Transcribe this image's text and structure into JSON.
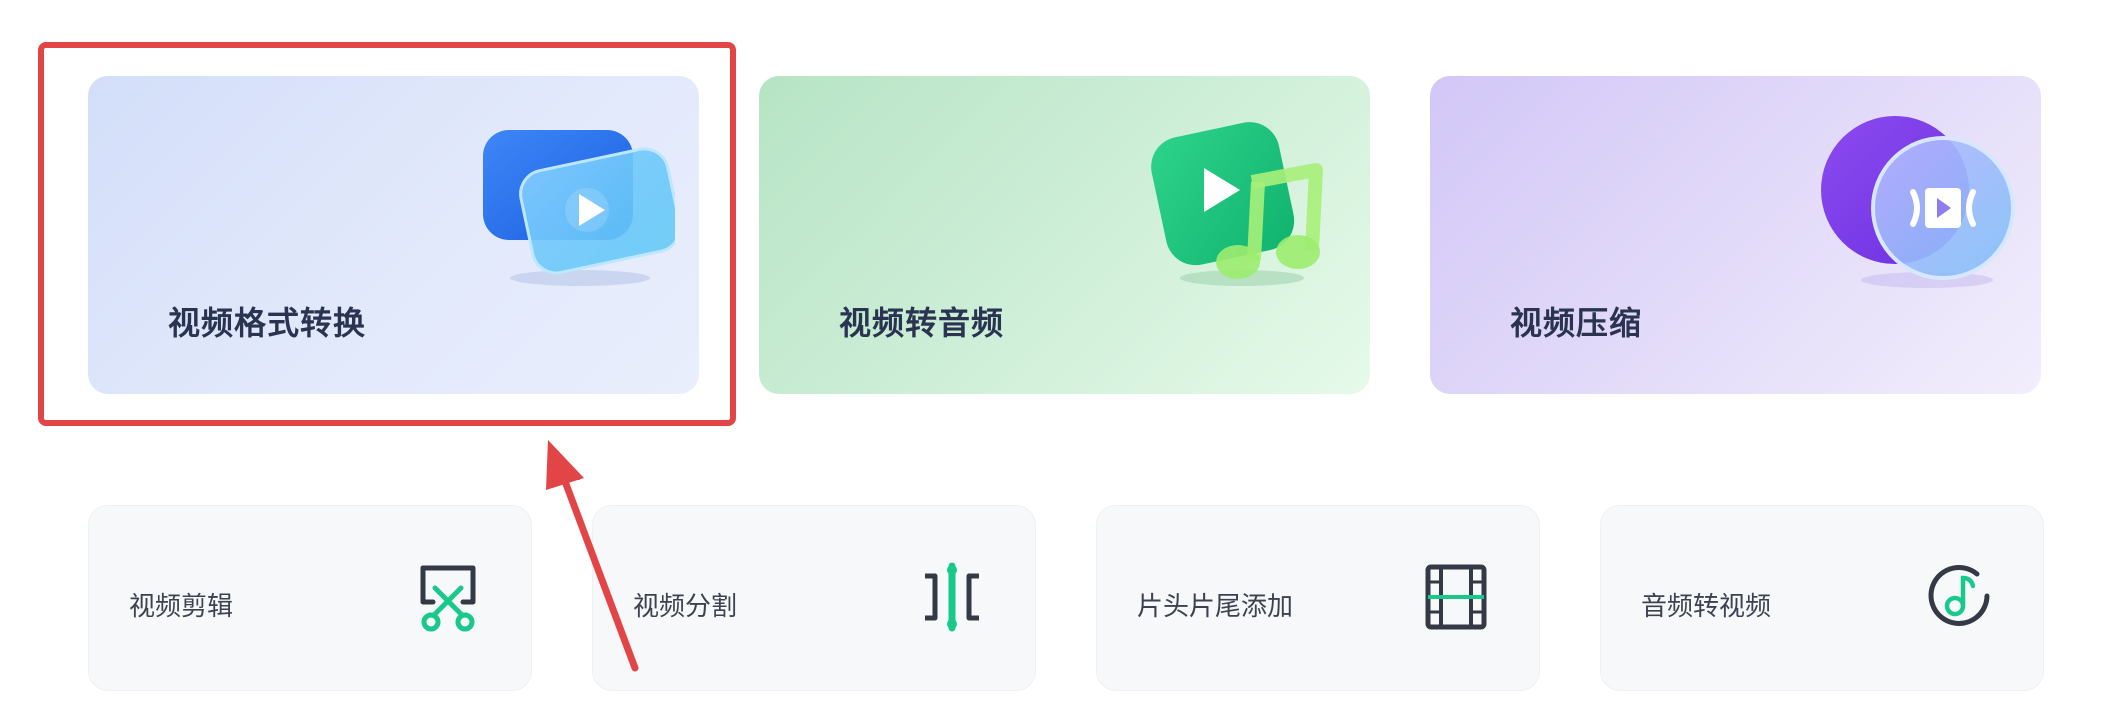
{
  "featured_tools": [
    {
      "label": "视频格式转换",
      "icon": "video-convert-icon"
    },
    {
      "label": "视频转音频",
      "icon": "video-to-audio-icon"
    },
    {
      "label": "视频压缩",
      "icon": "video-compress-icon"
    }
  ],
  "tools": [
    {
      "label": "视频剪辑",
      "icon": "scissors-icon"
    },
    {
      "label": "视频分割",
      "icon": "split-icon"
    },
    {
      "label": "片头片尾添加",
      "icon": "film-strip-icon"
    },
    {
      "label": "音频转视频",
      "icon": "music-note-icon"
    }
  ],
  "colors": {
    "accent_green": "#19c98a",
    "highlight_red": "#e24545",
    "text_dark": "#2a3450"
  }
}
